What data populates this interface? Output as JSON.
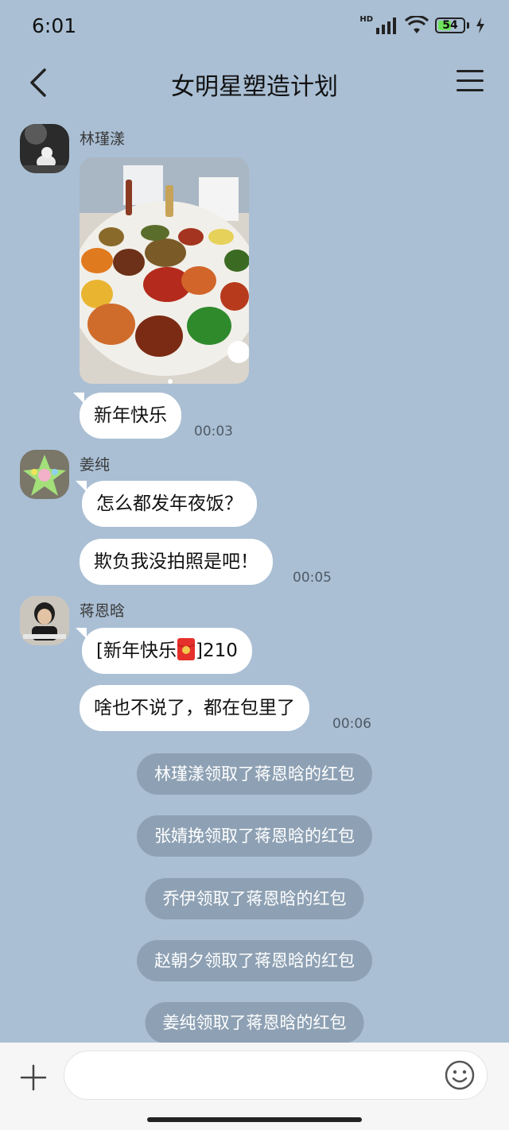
{
  "status": {
    "time": "6:01",
    "hd": "HD",
    "battery": "54",
    "battery_level": 0.54
  },
  "header": {
    "title": "女明星塑造计划",
    "back_icon": "chevron-left-icon",
    "menu_icon": "menu-icon"
  },
  "messages": [
    {
      "sender": "林瑾漾",
      "photo": "new-year-dinner-photo",
      "text": "新年快乐",
      "time": "00:03"
    },
    {
      "sender": "姜纯",
      "texts": [
        "怎么都发年夜饭？",
        "欺负我没拍照是吧！"
      ],
      "time": "00:05"
    },
    {
      "sender": "蒋恩晗",
      "redpacket_prefix": "[新年快乐",
      "redpacket_suffix": "]210",
      "text": "啥也不说了，都在包里了",
      "time": "00:06"
    }
  ],
  "system_notices": [
    "林瑾漾领取了蒋恩晗的红包",
    "张婧挽领取了蒋恩晗的红包",
    "乔伊领取了蒋恩晗的红包",
    "赵朝夕领取了蒋恩晗的红包",
    "姜纯领取了蒋恩晗的红包"
  ],
  "input": {
    "placeholder": "",
    "plus_icon": "plus-icon",
    "emoji_icon": "emoji-icon"
  },
  "colors": {
    "background": "#aabfd4",
    "bubble": "#ffffff",
    "system_pill": "#8ea1b4",
    "red_packet": "#e6302b"
  }
}
